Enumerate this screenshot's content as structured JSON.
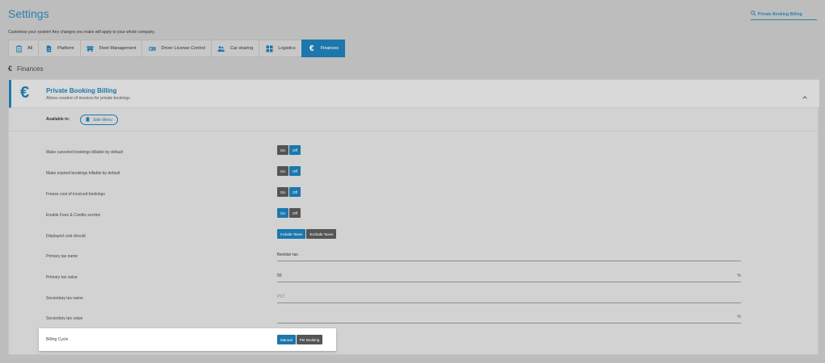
{
  "page": {
    "title": "Settings",
    "subtitle": "Customise your system! Any changes you make will apply to your whole company."
  },
  "search": {
    "value": "Private Booking Billing",
    "icon": "search-icon"
  },
  "tabs": [
    {
      "label": "All",
      "icon": "clipboard-icon",
      "active": false
    },
    {
      "label": "Platform",
      "icon": "document-icon",
      "active": false
    },
    {
      "label": "Fleet Management",
      "icon": "car-icon",
      "active": false
    },
    {
      "label": "Driver License Control",
      "icon": "id-card-icon",
      "active": false
    },
    {
      "label": "Car sharing",
      "icon": "people-icon",
      "active": false
    },
    {
      "label": "Logistics",
      "icon": "grid-icon",
      "active": false
    },
    {
      "label": "Finances",
      "icon": "euro-icon",
      "active": true
    }
  ],
  "section": {
    "icon_glyph": "€",
    "title": "Finances"
  },
  "card": {
    "icon_glyph": "€",
    "title": "Private Booking Billing",
    "description": "Allows creation of invoices for private bookings.",
    "available_label": "Available in:",
    "available_pill": "Side Menu"
  },
  "settings": [
    {
      "label": "Make canceled bookings billable by default",
      "on": "On",
      "off": "Off",
      "selected": "Off"
    },
    {
      "label": "Make expired bookings billable by default",
      "on": "On",
      "off": "Off",
      "selected": "Off"
    },
    {
      "label": "Freeze cost of invoiced bookings",
      "on": "On",
      "off": "Off",
      "selected": "Off"
    },
    {
      "label": "Enable Fees & Credits section",
      "on": "On",
      "off": "Off",
      "selected": "On"
    }
  ],
  "displayed_cost": {
    "label": "Displayed cost should",
    "option_a": "Include Taxes",
    "option_b": "Exclude Taxes",
    "selected": "Include Taxes"
  },
  "fields": {
    "primary_tax_name": {
      "label": "Primary tax name",
      "value": "fleetster tax"
    },
    "primary_tax_value": {
      "label": "Primary tax value",
      "value": "50",
      "suffix": "%"
    },
    "secondary_tax_name": {
      "label": "Secondary tax name",
      "placeholder": "PST"
    },
    "secondary_tax_value": {
      "label": "Secondary tax value",
      "value": "",
      "suffix": "%"
    }
  },
  "billing_cycle": {
    "label": "Billing Cycle",
    "option_a": "Manual",
    "option_b": "Per Booking",
    "selected": "Manual"
  },
  "colors": {
    "accent": "#1c77ac",
    "background": "#bdbdbd",
    "dim_button": "#555555"
  }
}
